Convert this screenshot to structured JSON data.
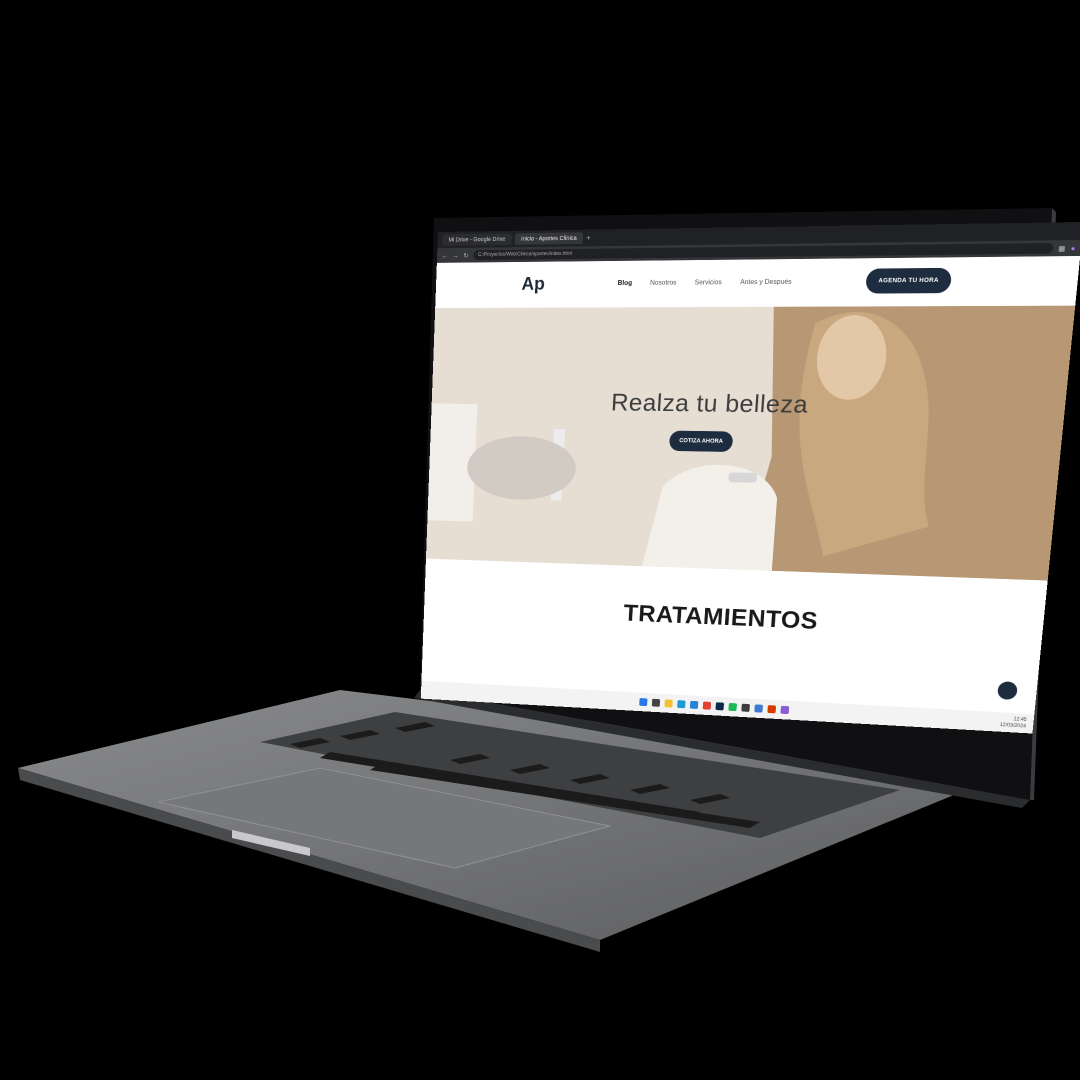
{
  "browser": {
    "tabs": [
      {
        "label": "Mi Drive - Google Drive",
        "active": false
      },
      {
        "label": "Inicio - Aportes Clínica",
        "active": true
      }
    ],
    "new_tab": "+",
    "url": "C:/Proyectos/Web/Clinica/aportes/index.html"
  },
  "site": {
    "logo": "Ap",
    "menu": [
      "Blog",
      "Nosotros",
      "Servicios",
      "Antes y Después"
    ],
    "cta_top": "AGENDA TU HORA",
    "hero": {
      "title": "Realza tu belleza",
      "cta": "COTIZA AHORA"
    },
    "section_title": "TRATAMIENTOS"
  },
  "taskbar": {
    "clock_time": "12:45",
    "clock_date": "12/03/2024"
  },
  "colors": {
    "brand_dark": "#1e2c40",
    "laptop_body": "#6f7072",
    "background": "#000000"
  }
}
